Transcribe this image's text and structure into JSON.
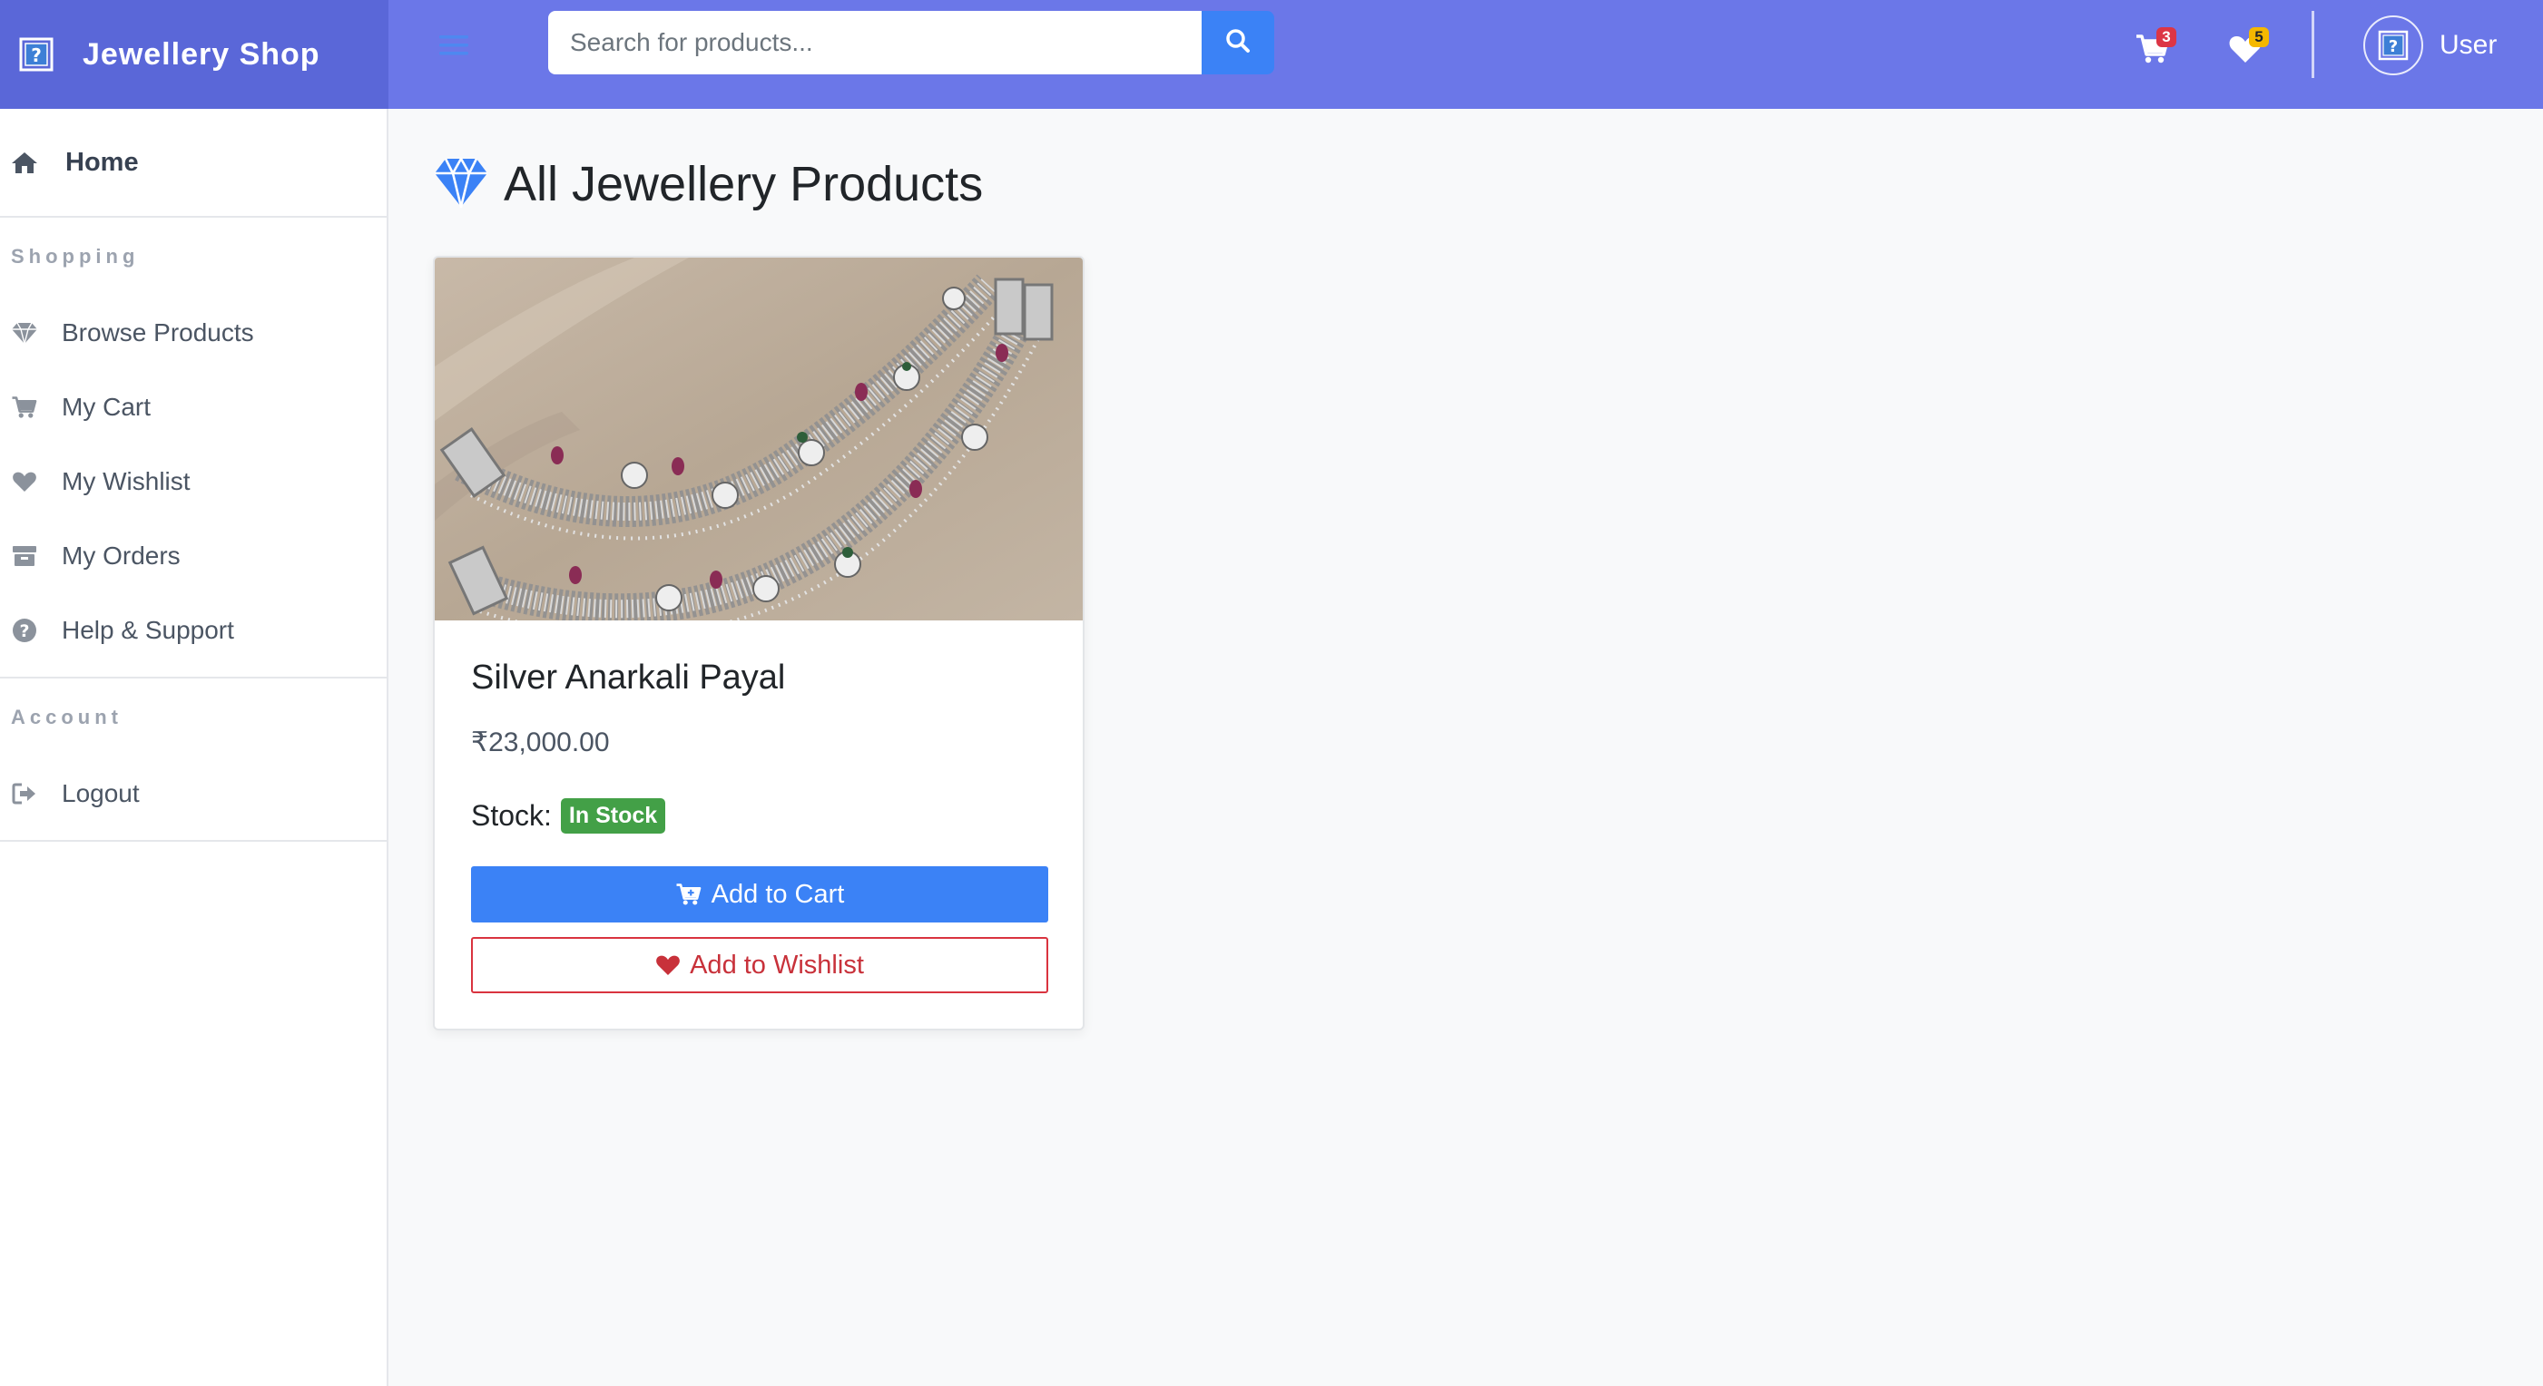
{
  "header": {
    "brand_name": "Jewellery Shop",
    "brand_icon": "question-box-icon",
    "menu_icon": "hamburger-icon",
    "search_placeholder": "Search for products...",
    "search_icon": "search-icon",
    "cart_icon": "cart-icon",
    "cart_count": "3",
    "wishlist_icon": "heart-icon",
    "wishlist_count": "5",
    "user_icon": "question-box-icon",
    "user_label": "User"
  },
  "sidebar": {
    "home": {
      "label": "Home",
      "icon": "home-icon"
    },
    "sections": [
      {
        "heading": "Shopping",
        "items": [
          {
            "label": "Browse Products",
            "icon": "diamond-icon"
          },
          {
            "label": "My Cart",
            "icon": "cart-icon"
          },
          {
            "label": "My Wishlist",
            "icon": "heart-icon"
          },
          {
            "label": "My Orders",
            "icon": "box-icon"
          },
          {
            "label": "Help & Support",
            "icon": "question-circle-icon"
          }
        ]
      },
      {
        "heading": "Account",
        "items": [
          {
            "label": "Logout",
            "icon": "sign-out-icon"
          }
        ]
      }
    ]
  },
  "main": {
    "title": "All Jewellery Products",
    "title_icon": "diamond-icon",
    "products": [
      {
        "name": "Silver Anarkali Payal",
        "price": "₹23,000.00",
        "stock_label": "Stock:",
        "stock_status": "In Stock",
        "add_to_cart_label": "Add to Cart",
        "add_to_wishlist_label": "Add to Wishlist"
      }
    ]
  },
  "colors": {
    "header_bg": "#6b77e8",
    "brand_bg": "#5a67d8",
    "primary": "#3b82f6",
    "danger": "#c8313a",
    "success": "#43a047",
    "cart_badge": "#dc3545",
    "wishlist_badge": "#f5b800"
  }
}
